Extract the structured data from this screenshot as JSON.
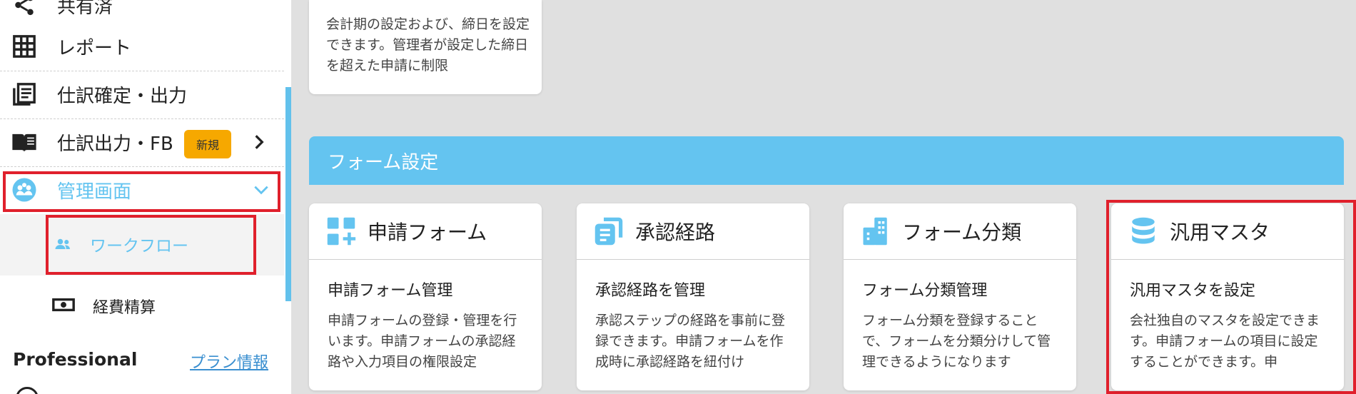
{
  "sidebar": {
    "items": [
      {
        "label": "共有済",
        "icon": "share-icon"
      },
      {
        "label": "レポート",
        "icon": "grid-table-icon"
      },
      {
        "label": "仕訳確定・出力",
        "icon": "journal-list-icon"
      },
      {
        "label": "仕訳出力・FB",
        "icon": "open-book-icon",
        "badge": "新規"
      },
      {
        "label": "管理画面",
        "icon": "admin-people-icon"
      }
    ],
    "sub_items": [
      {
        "label": "ワークフロー",
        "icon": "users-icon"
      },
      {
        "label": "経費精算",
        "icon": "money-icon"
      }
    ],
    "plan_name": "Professional",
    "plan_link": "プラン情報"
  },
  "main": {
    "top_card_desc": "会計期の設定および、締日を設定できます。管理者が設定した締日を超えた申請に制限",
    "section_title": "フォーム設定",
    "cards": [
      {
        "title": "申請フォーム",
        "icon": "form-add-icon",
        "sub": "申請フォーム管理",
        "desc": "申請フォームの登録・管理を行います。申請フォームの承認経路や入力項目の権限設定"
      },
      {
        "title": "承認経路",
        "icon": "route-docs-icon",
        "sub": "承認経路を管理",
        "desc": "承認ステップの経路を事前に登録できます。申請フォームを作成時に承認経路を紐付け"
      },
      {
        "title": "フォーム分類",
        "icon": "buildings-icon",
        "sub": "フォーム分類管理",
        "desc": "フォーム分類を登録することで、フォームを分類分けして管理できるようになります"
      },
      {
        "title": "汎用マスタ",
        "icon": "database-icon",
        "sub": "汎用マスタを設定",
        "desc": "会社独自のマスタを設定できます。申請フォームの項目に設定することができます。申"
      }
    ]
  },
  "colors": {
    "accent": "#64c4f0",
    "highlight": "#e0202c",
    "badge": "#f6a800"
  }
}
